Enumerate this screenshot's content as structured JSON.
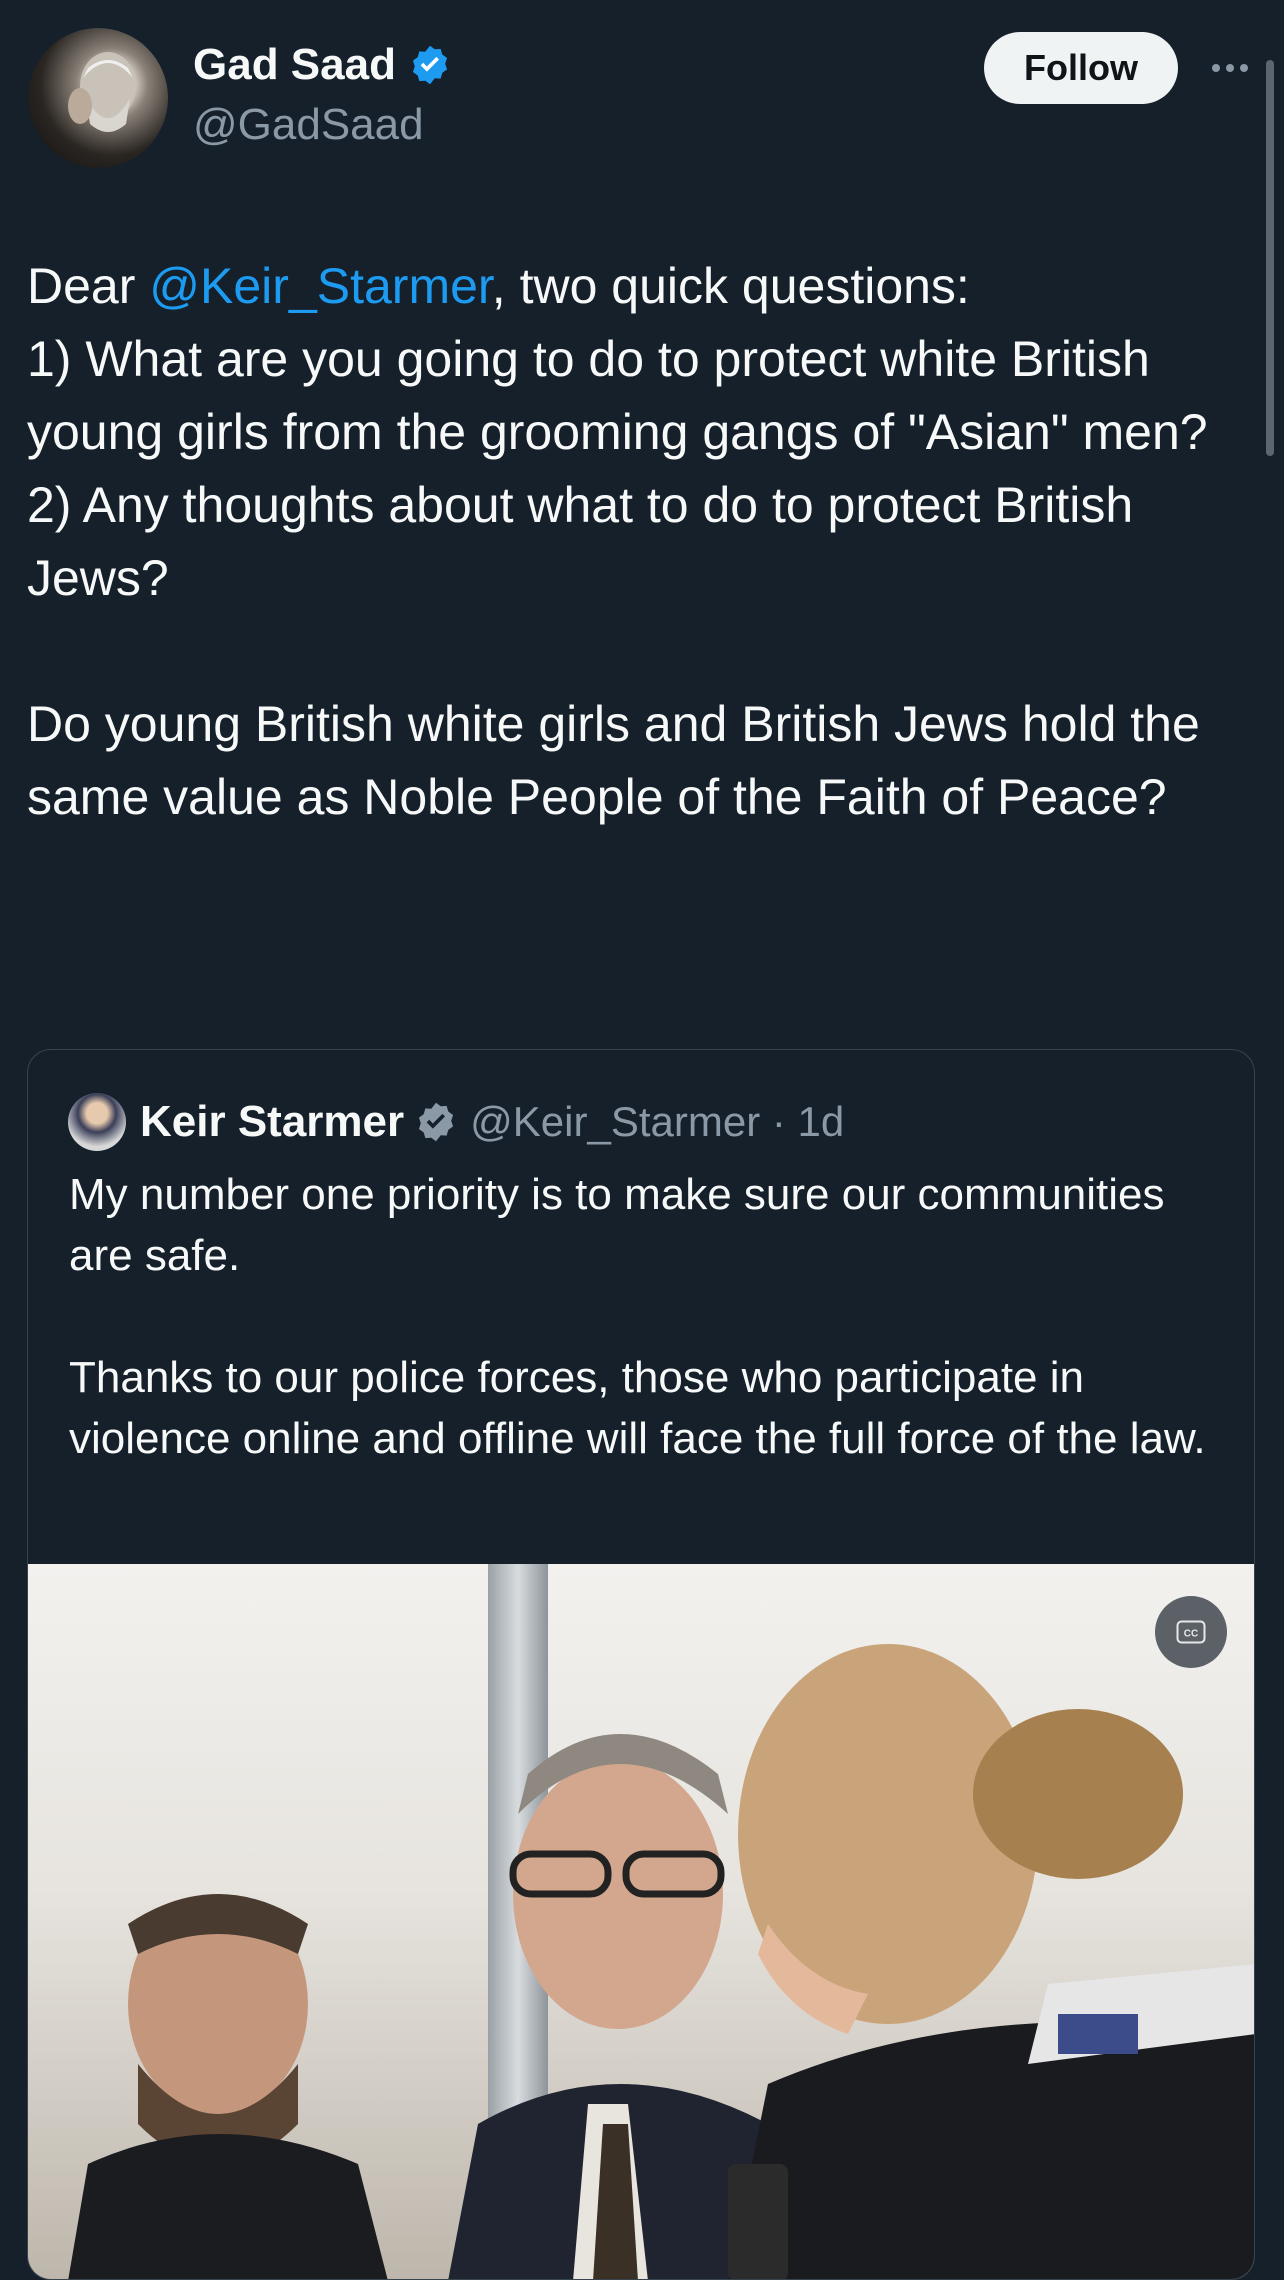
{
  "author": {
    "display_name": "Gad Saad",
    "handle": "@GadSaad",
    "avatar_icon": "avatar-photo"
  },
  "follow_label": "Follow",
  "more_icon": "ellipsis-icon",
  "tweet": {
    "line1_pre": "Dear ",
    "mention": "@Keir_Starmer",
    "line1_post": ", two quick questions:",
    "q1": "1) What are you going to do to protect white British young girls from the grooming gangs of \"Asian\" men?",
    "q2": "2) Any thoughts about what to do to protect British Jews?",
    "closing": "Do young British white girls and British Jews hold the same value as Noble People of the Faith of Peace?"
  },
  "quoted": {
    "display_name": "Keir Starmer",
    "handle_time": "@Keir_Starmer · 1d",
    "para1": "My number one priority is to make sure our communities are safe.",
    "para2": "Thanks to our police forces, those who participate in violence online and offline will face the full force of the law.",
    "cc_label": "CC"
  },
  "colors": {
    "background": "#15202b",
    "accent": "#1d9bf0",
    "verified": "#1d9bf0",
    "secondary_text": "#8b98a5"
  }
}
